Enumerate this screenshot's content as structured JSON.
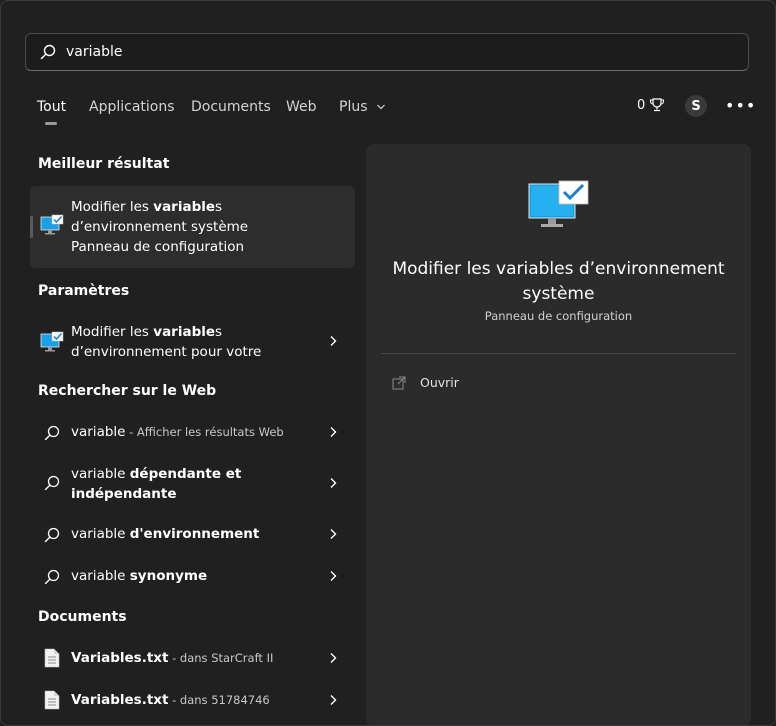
{
  "search": {
    "value": "variable",
    "icon": "search-icon"
  },
  "tabs": [
    {
      "label": "Tout",
      "active": true
    },
    {
      "label": "Applications"
    },
    {
      "label": "Documents"
    },
    {
      "label": "Web"
    },
    {
      "label": "Plus"
    }
  ],
  "header": {
    "rewards_count": "0",
    "avatar_initial": "S",
    "more_label": "•••"
  },
  "sections": {
    "best": "Meilleur résultat",
    "settings": "Paramètres",
    "web": "Rechercher sur le Web",
    "documents": "Documents"
  },
  "best_result": {
    "line1_prefix": "Modifier les ",
    "line1_bold": "variable",
    "line1_suffix": "s",
    "line2": "d’environnement système",
    "subtitle": "Panneau de configuration"
  },
  "settings_items": [
    {
      "prefix": "Modifier les ",
      "bold": "variable",
      "suffix": "s",
      "line2": "d’environnement pour votre"
    }
  ],
  "web_items": [
    {
      "prefix": "variable",
      "bold": "",
      "extra": " - Afficher les résultats Web"
    },
    {
      "prefix": "variable ",
      "bold": "dépendante et",
      "line2": "indépendante"
    },
    {
      "prefix": "variable ",
      "bold": "d'environnement"
    },
    {
      "prefix": "variable ",
      "bold": "synonyme"
    }
  ],
  "document_items": [
    {
      "name": "Variables.txt",
      "location": " - dans StarCraft II"
    },
    {
      "name": "Variables.txt",
      "location": " - dans 51784746"
    }
  ],
  "detail": {
    "title": "Modifier les variables d’environnement système",
    "subtitle": "Panneau de configuration",
    "open_label": "Ouvrir"
  },
  "colors": {
    "accent": "#0078d4",
    "panel": "#2b2b2b",
    "background": "#202020"
  }
}
